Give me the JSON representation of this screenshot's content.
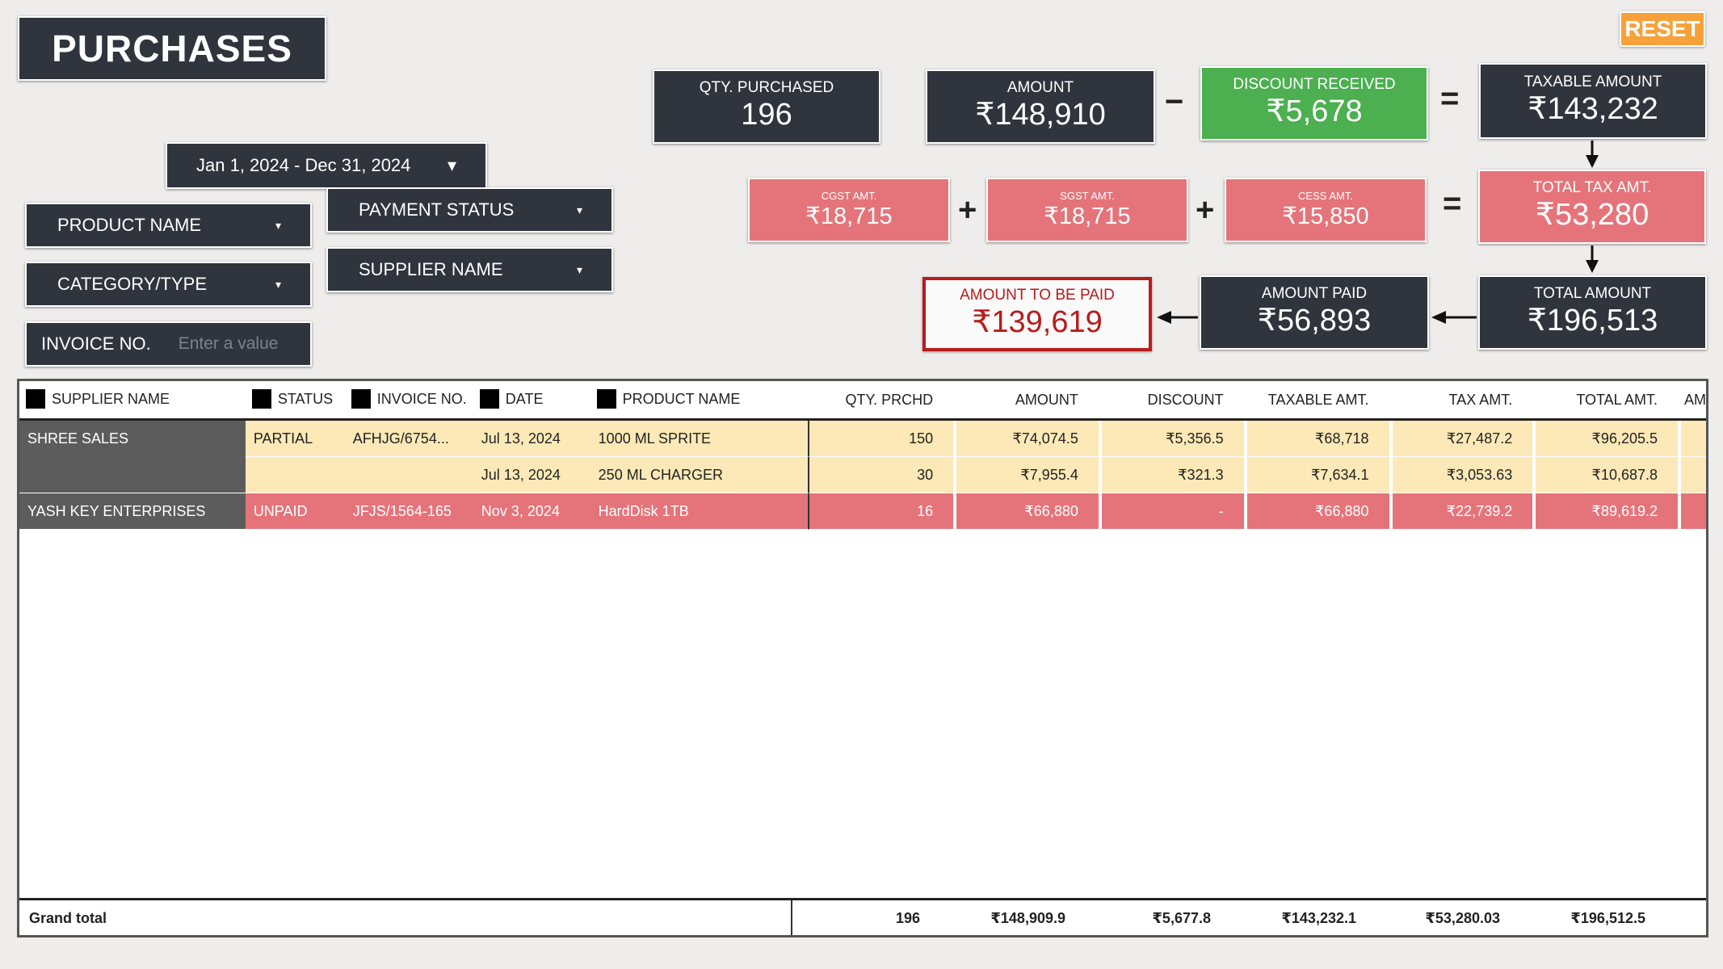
{
  "title": "PURCHASES",
  "reset_label": "RESET",
  "filters": {
    "date_range": "Jan 1, 2024 - Dec 31, 2024",
    "product_name": "PRODUCT NAME",
    "category": "CATEGORY/TYPE",
    "payment_status": "PAYMENT STATUS",
    "supplier_name": "SUPPLIER NAME",
    "invoice_label": "INVOICE NO.",
    "invoice_placeholder": "Enter a value"
  },
  "kpi": {
    "qty": {
      "label": "QTY. PURCHASED",
      "value": "196"
    },
    "amount": {
      "label": "AMOUNT",
      "value": "₹148,910"
    },
    "discount": {
      "label": "DISCOUNT RECEIVED",
      "value": "₹5,678"
    },
    "taxable": {
      "label": "TAXABLE AMOUNT",
      "value": "₹143,232"
    },
    "cgst": {
      "label": "CGST AMT.",
      "value": "₹18,715"
    },
    "sgst": {
      "label": "SGST AMT.",
      "value": "₹18,715"
    },
    "cess": {
      "label": "CESS AMT.",
      "value": "₹15,850"
    },
    "total_tax": {
      "label": "TOTAL TAX AMT.",
      "value": "₹53,280"
    },
    "to_be_paid": {
      "label": "AMOUNT TO BE PAID",
      "value": "₹139,619"
    },
    "paid": {
      "label": "AMOUNT PAID",
      "value": "₹56,893"
    },
    "total": {
      "label": "TOTAL AMOUNT",
      "value": "₹196,513"
    }
  },
  "operators": {
    "minus": "−",
    "plus": "+",
    "equals": "="
  },
  "table": {
    "headers": [
      "SUPPLIER NAME",
      "STATUS",
      "INVOICE NO.",
      "DATE",
      "PRODUCT NAME",
      "QTY. PRCHD",
      "AMOUNT",
      "DISCOUNT",
      "TAXABLE AMT.",
      "TAX AMT.",
      "TOTAL AMT.",
      "AMOUNT"
    ],
    "rows": [
      {
        "supplier": "SHREE SALES",
        "status": "PARTIAL",
        "invoice": "AFHJG/6754...",
        "date": "Jul 13, 2024",
        "product": "1000 ML SPRITE",
        "qty": "150",
        "amount": "₹74,074.5",
        "discount": "₹5,356.5",
        "taxable": "₹68,718",
        "tax": "₹27,487.2",
        "total": "₹96,205.5"
      },
      {
        "supplier": "",
        "status": "",
        "invoice": "",
        "date": "Jul 13, 2024",
        "product": "250 ML CHARGER",
        "qty": "30",
        "amount": "₹7,955.4",
        "discount": "₹321.3",
        "taxable": "₹7,634.1",
        "tax": "₹3,053.63",
        "total": "₹10,687.8"
      },
      {
        "supplier": "YASH KEY ENTERPRISES",
        "status": "UNPAID",
        "invoice": "JFJS/1564-165",
        "date": "Nov 3, 2024",
        "product": "HardDisk 1TB",
        "qty": "16",
        "amount": "₹66,880",
        "discount": "-",
        "taxable": "₹66,880",
        "tax": "₹22,739.2",
        "total": "₹89,619.2"
      }
    ],
    "grand_total": {
      "label": "Grand total",
      "qty": "196",
      "amount": "₹148,909.9",
      "discount": "₹5,677.8",
      "taxable": "₹143,232.1",
      "tax": "₹53,280.03",
      "total": "₹196,512.5"
    }
  }
}
